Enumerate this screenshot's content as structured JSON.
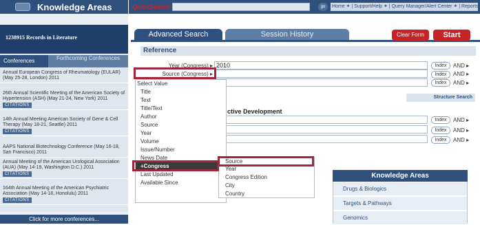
{
  "sidebar": {
    "header": "Knowledge Areas",
    "records": "1238915 Records in Literature",
    "tabs": [
      "Conferences",
      "Forthcoming Conferences"
    ],
    "conferences": [
      {
        "text": "Annual European Congress of Rheumatology (EULAR) (May 25-28, London) 2011",
        "badge": ""
      },
      {
        "text": "26th Annual Scientific Meeting of the American Society of Hypertension (ASH) (May 21-24, New York) 2011",
        "badge": "CITATIONS"
      },
      {
        "text": "14th Annual Meeting American Society of Gene & Cell Therapy (May 18-21, Seattle) 2011",
        "badge": "CITATIONS"
      },
      {
        "text": "AAPS National Biotechnology Conference (May 16-18, San Francisco) 2011",
        "badge": ""
      },
      {
        "text": "Annual Meeting of the American Urological Association (AUA) (May 14-19, Washington D.C.) 2011",
        "badge": "CITATIONS"
      },
      {
        "text": "164th Annual Meeting of the American Psychiatric Association (May 14-18, Honolulu) 2011",
        "badge": "CITATIONS"
      }
    ],
    "more": "Click for more conferences..."
  },
  "topbar": {
    "quicksearch": "QuickSearch",
    "go": "go",
    "links": "Home ✦ | Support/Help ✦ | Query Manager/Alert Center ✦ | Reports ✦"
  },
  "main": {
    "tabs": [
      "Advanced Search",
      "Session History"
    ],
    "clear": "Clear Form",
    "start": "Start",
    "reference": "Reference",
    "row1_label": "Year (Congress)",
    "row1_value": "2010",
    "row2_label": "Source (Congress)",
    "index": "Index",
    "and": "AND ▸",
    "structure": "Structure Search",
    "section2": "ctive Development"
  },
  "menu1": {
    "items": [
      "Select Value",
      "Title",
      "Text",
      "Title/Text",
      "Author",
      "Source",
      "Year",
      "Volume",
      "Issue/Number",
      "News Date",
      "Congress",
      "Last Updated",
      "Available Since"
    ]
  },
  "menu2": {
    "items": [
      "Source",
      "Year",
      "Congress Edition",
      "City",
      "Country"
    ]
  },
  "knowledge": {
    "header": "Knowledge Areas",
    "items": [
      "Drugs & Biologics",
      "Targets & Pathways",
      "Genomics"
    ]
  }
}
